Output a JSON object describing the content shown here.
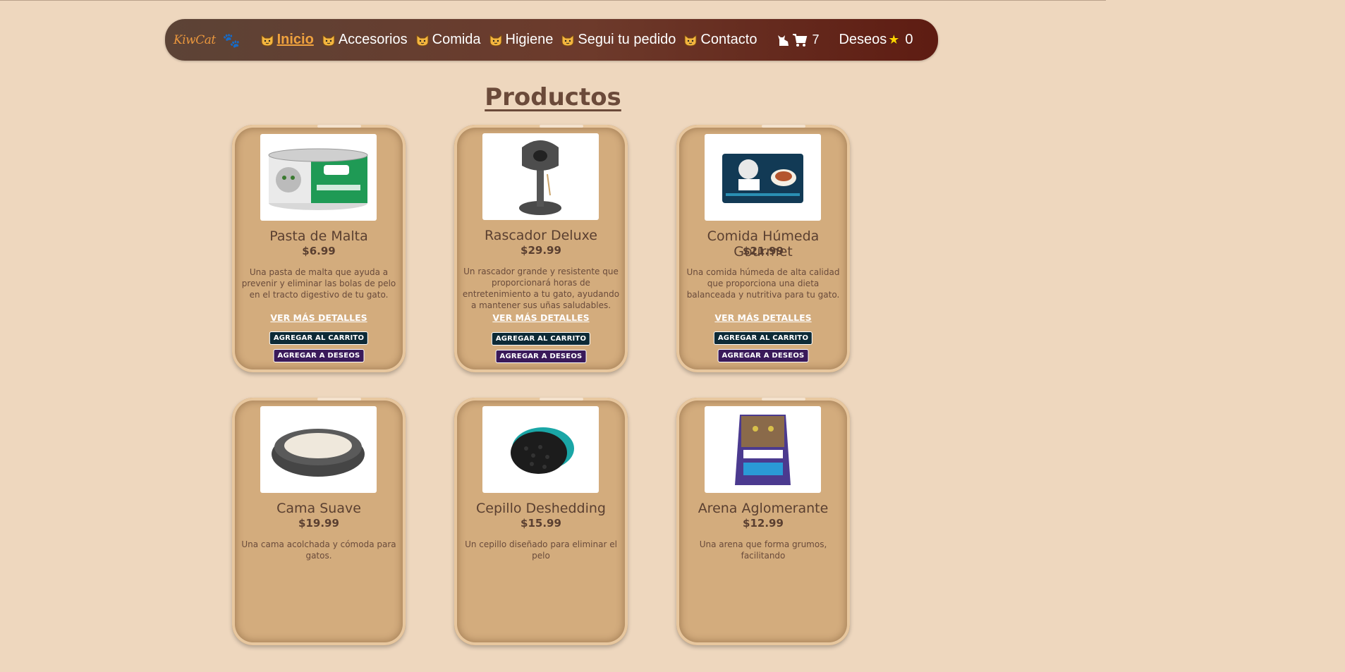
{
  "nav": {
    "logo_text": "KiwCat",
    "items": [
      {
        "label": "Inicio",
        "active": true
      },
      {
        "label": "Accesorios"
      },
      {
        "label": "Comida"
      },
      {
        "label": "Higiene"
      },
      {
        "label": "Segui tu pedido"
      },
      {
        "label": "Contacto"
      }
    ],
    "cart_count": "7",
    "wishlist_label": "Deseos",
    "wishlist_count": "0"
  },
  "page_title": "Productos",
  "products": [
    {
      "name": "Pasta de Malta",
      "price": "$6.99",
      "description": "Una pasta de malta que ayuda a prevenir y eliminar las bolas de pelo en el tracto digestivo de tu gato.",
      "image_icon": "cat-food-can"
    },
    {
      "name": "Rascador Deluxe",
      "price": "$29.99",
      "description": "Un rascador grande y resistente que proporcionará horas de entretenimiento a tu gato, ayudando a mantener sus uñas saludables.",
      "image_icon": "scratching-post"
    },
    {
      "name": "Comida Húmeda Gourmet",
      "price": "$21.99",
      "description": "Una comida húmeda de alta calidad que proporciona una dieta balanceada y nutritiva para tu gato.",
      "image_icon": "wet-food-pouch"
    },
    {
      "name": "Cama Suave",
      "price": "$19.99",
      "description": "Una cama acolchada y cómoda para gatos.",
      "image_icon": "cat-bed"
    },
    {
      "name": "Cepillo Deshedding",
      "price": "$15.99",
      "description": "Un cepillo diseñado para eliminar el pelo",
      "image_icon": "deshedding-brush"
    },
    {
      "name": "Arena Aglomerante",
      "price": "$12.99",
      "description": "Una arena que forma grumos, facilitando",
      "image_icon": "litter-bag"
    }
  ],
  "labels": {
    "more_details": "VER MÁS DETALLES",
    "add_to_cart": "AGREGAR AL CARRITO",
    "add_to_wishlist": "AGREGAR A DESEOS"
  },
  "colors": {
    "background": "#eed7be",
    "card": "#d3ac7d",
    "nav_gradient_start": "#5c4336",
    "nav_gradient_end": "#5e1c12",
    "accent": "#f0a23e",
    "cart_button": "#0d2a36",
    "wish_button": "#3a1a5a"
  }
}
